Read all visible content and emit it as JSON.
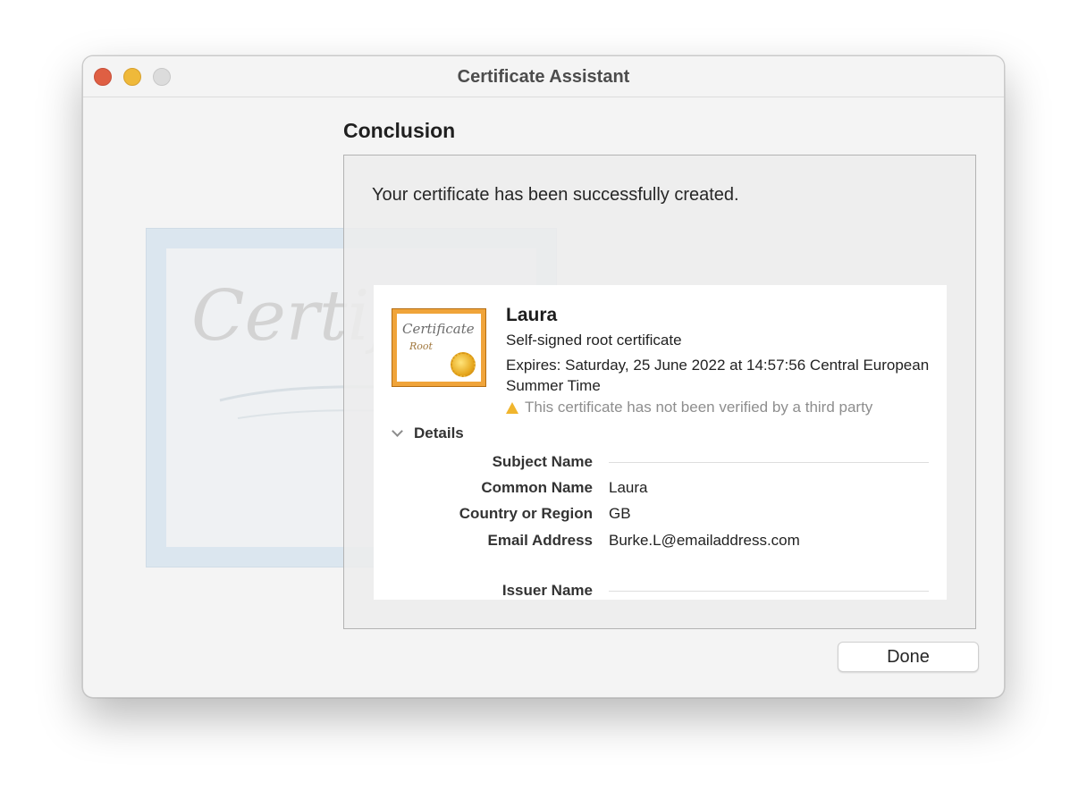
{
  "window": {
    "title": "Certificate Assistant"
  },
  "conclusion": {
    "heading": "Conclusion",
    "message": "Your certificate has been successfully created."
  },
  "certificate": {
    "thumb_title": "Certificate",
    "thumb_subtitle": "Root",
    "name": "Laura",
    "type": "Self-signed root certificate",
    "expires": "Expires: Saturday, 25 June 2022 at 14:57:56 Central European Summer Time",
    "warning": "This certificate has not been verified by a third party"
  },
  "details": {
    "label": "Details",
    "subject_name_label": "Subject Name",
    "common_name_label": "Common Name",
    "common_name_value": "Laura",
    "country_label": "Country or Region",
    "country_value": "GB",
    "email_label": "Email Address",
    "email_value": "Burke.L@emailaddress.com",
    "issuer_name_label": "Issuer Name"
  },
  "buttons": {
    "done": "Done"
  },
  "colors": {
    "close": "#df5f43",
    "minimize": "#efb93a",
    "maximize": "#dcdcdc",
    "warning": "#f0b52d"
  },
  "icons": [
    "close-icon",
    "minimize-icon",
    "maximize-icon",
    "certificate-icon",
    "warning-icon",
    "chevron-down-icon"
  ]
}
